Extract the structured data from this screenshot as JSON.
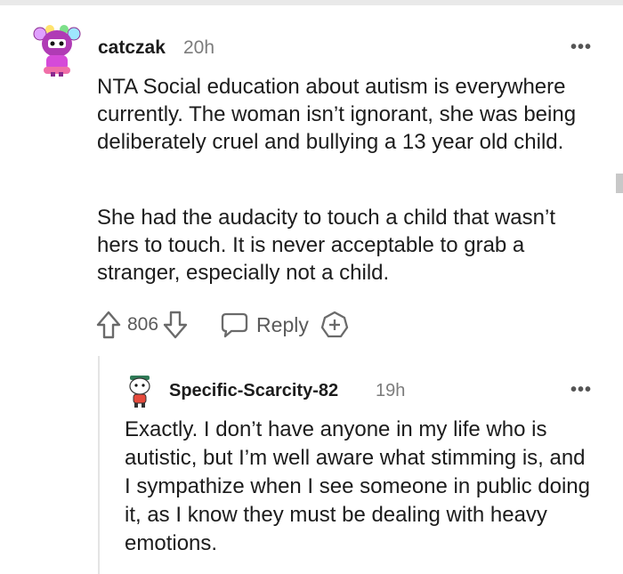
{
  "comment": {
    "username": "catczak",
    "time": "20h",
    "more_label": "•••",
    "paragraphs": [
      "NTA Social education about autism is everywhere currently. The woman isn’t ignorant, she was being deliberately cruel and bullying a 13 year old child.",
      "She had the audacity to touch a child that wasn’t hers to touch. It is never acceptable to grab a stranger, especially not a child."
    ],
    "score": "806",
    "reply_label": "Reply",
    "icons": {
      "upvote": "arrow-up-icon",
      "downvote": "arrow-down-icon",
      "reply": "speech-bubble-icon",
      "award": "award-plus-icon",
      "more": "ellipsis-icon"
    }
  },
  "reply": {
    "username": "Specific-Scarcity-82",
    "time": "19h",
    "more_label": "•••",
    "text": "Exactly. I don’t have anyone in my life who is autistic, but I’m well aware what stimming is, and I sympathize when I see someone in public doing it, as I know they must be dealing with heavy emotions."
  },
  "colors": {
    "text": "#1c1c1c",
    "meta": "#7c7c7c",
    "icon": "#6a6a6a",
    "divider": "#e4e4e4",
    "avatar_primary": "#b03bb5"
  }
}
